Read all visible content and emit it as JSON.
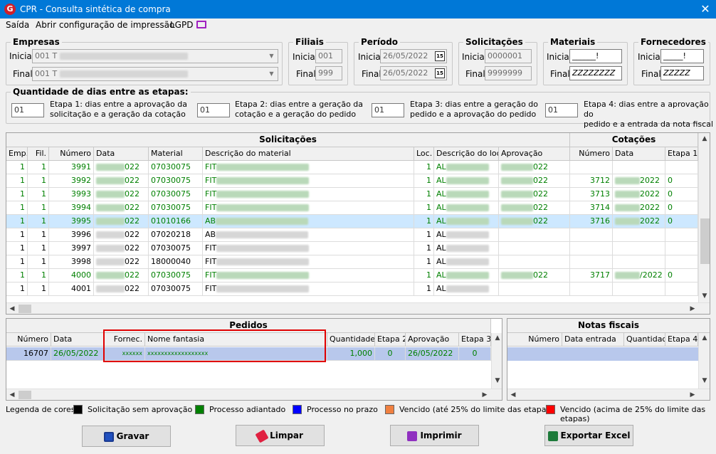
{
  "window": {
    "title": "CPR - Consulta sintética de compra",
    "close": "✕"
  },
  "menu": {
    "items": [
      "Saída",
      "Abrir configuração de impressão",
      "LGPD"
    ]
  },
  "filters": {
    "empresas": {
      "legend": "Empresas",
      "inicial_label": "Inicial",
      "inicial_value": "001 T",
      "final_label": "Final",
      "final_value": "001 T"
    },
    "filiais": {
      "legend": "Filiais",
      "inicial_label": "Inicial",
      "inicial_value": "001",
      "final_label": "Final",
      "final_value": "999"
    },
    "periodo": {
      "legend": "Período",
      "inicial_label": "Inicial",
      "inicial_value": "26/05/2022",
      "final_label": "Final",
      "final_value": "26/05/2022"
    },
    "solicitacoes": {
      "legend": "Solicitações",
      "inicial_label": "Inicial",
      "inicial_value": "0000001",
      "final_label": "Final",
      "final_value": "9999999"
    },
    "materiais": {
      "legend": "Materiais",
      "inicial_label": "Inicial",
      "inicial_value": "______!",
      "final_label": "Final",
      "final_value": "ZZZZZZZZ"
    },
    "fornecedores": {
      "legend": "Fornecedores",
      "inicial_label": "Inicial",
      "inicial_value": "_____!",
      "final_label": "Final",
      "final_value": "ZZZZZ"
    }
  },
  "etapas": {
    "legend": "Quantidade de dias entre as etapas:",
    "items": [
      {
        "value": "01",
        "line1": "Etapa 1: dias entre a aprovação da",
        "line2": "solicitação e a geração da cotação"
      },
      {
        "value": "01",
        "line1": "Etapa 2: dias entre a geração da",
        "line2": "cotação e a geração do pedido"
      },
      {
        "value": "01",
        "line1": "Etapa 3: dias entre a geração do",
        "line2": "pedido e a aprovação do pedido"
      },
      {
        "value": "01",
        "line1": "Etapa 4: dias entre a aprovação do",
        "line2": "pedido e a entrada da nota fiscal"
      }
    ]
  },
  "solicitacoes_grid": {
    "band_left": "Solicitações",
    "band_right": "Cotações",
    "columns": [
      "Emp.",
      "Fil.",
      "Número",
      "Data",
      "Material",
      "Descrição do material",
      "Loc.",
      "Descrição do local",
      "Aprovação",
      "Número",
      "Data",
      "Etapa 1"
    ],
    "rows": [
      {
        "emp": "1",
        "fil": "1",
        "numero": "3991",
        "data": "022",
        "material": "07030075",
        "desc": "FIT",
        "loc": "1",
        "local": "AL",
        "aprov": "022",
        "cot_num": "",
        "cot_data": "",
        "etapa1": "",
        "green": true
      },
      {
        "emp": "1",
        "fil": "1",
        "numero": "3992",
        "data": "022",
        "material": "07030075",
        "desc": "FIT",
        "loc": "1",
        "local": "AL",
        "aprov": "022",
        "cot_num": "3712",
        "cot_data": "2022",
        "etapa1": "0",
        "green": true
      },
      {
        "emp": "1",
        "fil": "1",
        "numero": "3993",
        "data": "022",
        "material": "07030075",
        "desc": "FIT",
        "loc": "1",
        "local": "AL",
        "aprov": "022",
        "cot_num": "3713",
        "cot_data": "2022",
        "etapa1": "0",
        "green": true
      },
      {
        "emp": "1",
        "fil": "1",
        "numero": "3994",
        "data": "022",
        "material": "07030075",
        "desc": "FIT",
        "loc": "1",
        "local": "AL",
        "aprov": "022",
        "cot_num": "3714",
        "cot_data": "2022",
        "etapa1": "0",
        "green": true
      },
      {
        "emp": "1",
        "fil": "1",
        "numero": "3995",
        "data": "022",
        "material": "01010166",
        "desc": "AB",
        "loc": "1",
        "local": "AL",
        "aprov": "022",
        "cot_num": "3716",
        "cot_data": "2022",
        "etapa1": "0",
        "green": true,
        "selected": true
      },
      {
        "emp": "1",
        "fil": "1",
        "numero": "3996",
        "data": "022",
        "material": "07020218",
        "desc": "AB",
        "loc": "1",
        "local": "AL",
        "aprov": "",
        "cot_num": "",
        "cot_data": "",
        "etapa1": "",
        "green": false
      },
      {
        "emp": "1",
        "fil": "1",
        "numero": "3997",
        "data": "022",
        "material": "07030075",
        "desc": "FIT",
        "loc": "1",
        "local": "AL",
        "aprov": "",
        "cot_num": "",
        "cot_data": "",
        "etapa1": "",
        "green": false
      },
      {
        "emp": "1",
        "fil": "1",
        "numero": "3998",
        "data": "022",
        "material": "18000040",
        "desc": "FIT",
        "loc": "1",
        "local": "AL",
        "aprov": "",
        "cot_num": "",
        "cot_data": "",
        "etapa1": "",
        "green": false
      },
      {
        "emp": "1",
        "fil": "1",
        "numero": "4000",
        "data": "022",
        "material": "07030075",
        "desc": "FIT",
        "loc": "1",
        "local": "AL",
        "aprov": "022",
        "cot_num": "3717",
        "cot_data": "/2022",
        "etapa1": "0",
        "green": true
      },
      {
        "emp": "1",
        "fil": "1",
        "numero": "4001",
        "data": "022",
        "material": "07030075",
        "desc": "FIT",
        "loc": "1",
        "local": "AL",
        "aprov": "",
        "cot_num": "",
        "cot_data": "",
        "etapa1": "",
        "green": false
      }
    ]
  },
  "pedidos_grid": {
    "band": "Pedidos",
    "columns": [
      "Número",
      "Data",
      "Fornec.",
      "Nome fantasia",
      "Quantidade",
      "Etapa 2",
      "Aprovação",
      "Etapa 3"
    ],
    "rows": [
      {
        "numero": "16707",
        "data": "26/05/2022",
        "fornec": "xxxxxx",
        "nome": "xxxxxxxxxxxxxxxxxx",
        "quantidade": "1,000",
        "etapa2": "0",
        "aprovacao": "26/05/2022",
        "etapa3": "0"
      }
    ]
  },
  "notas_grid": {
    "band": "Notas fiscais",
    "columns": [
      "Número",
      "Data entrada",
      "Quantidade",
      "Etapa 4"
    ]
  },
  "legend": {
    "title": "Legenda de cores:",
    "items": [
      {
        "label": "Solicitação sem aprovação",
        "color": "#000000"
      },
      {
        "label": "Processo adiantado",
        "color": "#008000"
      },
      {
        "label": "Processo no prazo",
        "color": "#0000ff"
      },
      {
        "label": "Vencido (até 25% do limite das etapas)",
        "color": "#f08040"
      },
      {
        "label": "Vencido (acima de 25% do limite das etapas)",
        "color": "#ff0000"
      }
    ]
  },
  "buttons": {
    "gravar": "Gravar",
    "limpar": "Limpar",
    "imprimir": "Imprimir",
    "exportar": "Exportar Excel"
  }
}
